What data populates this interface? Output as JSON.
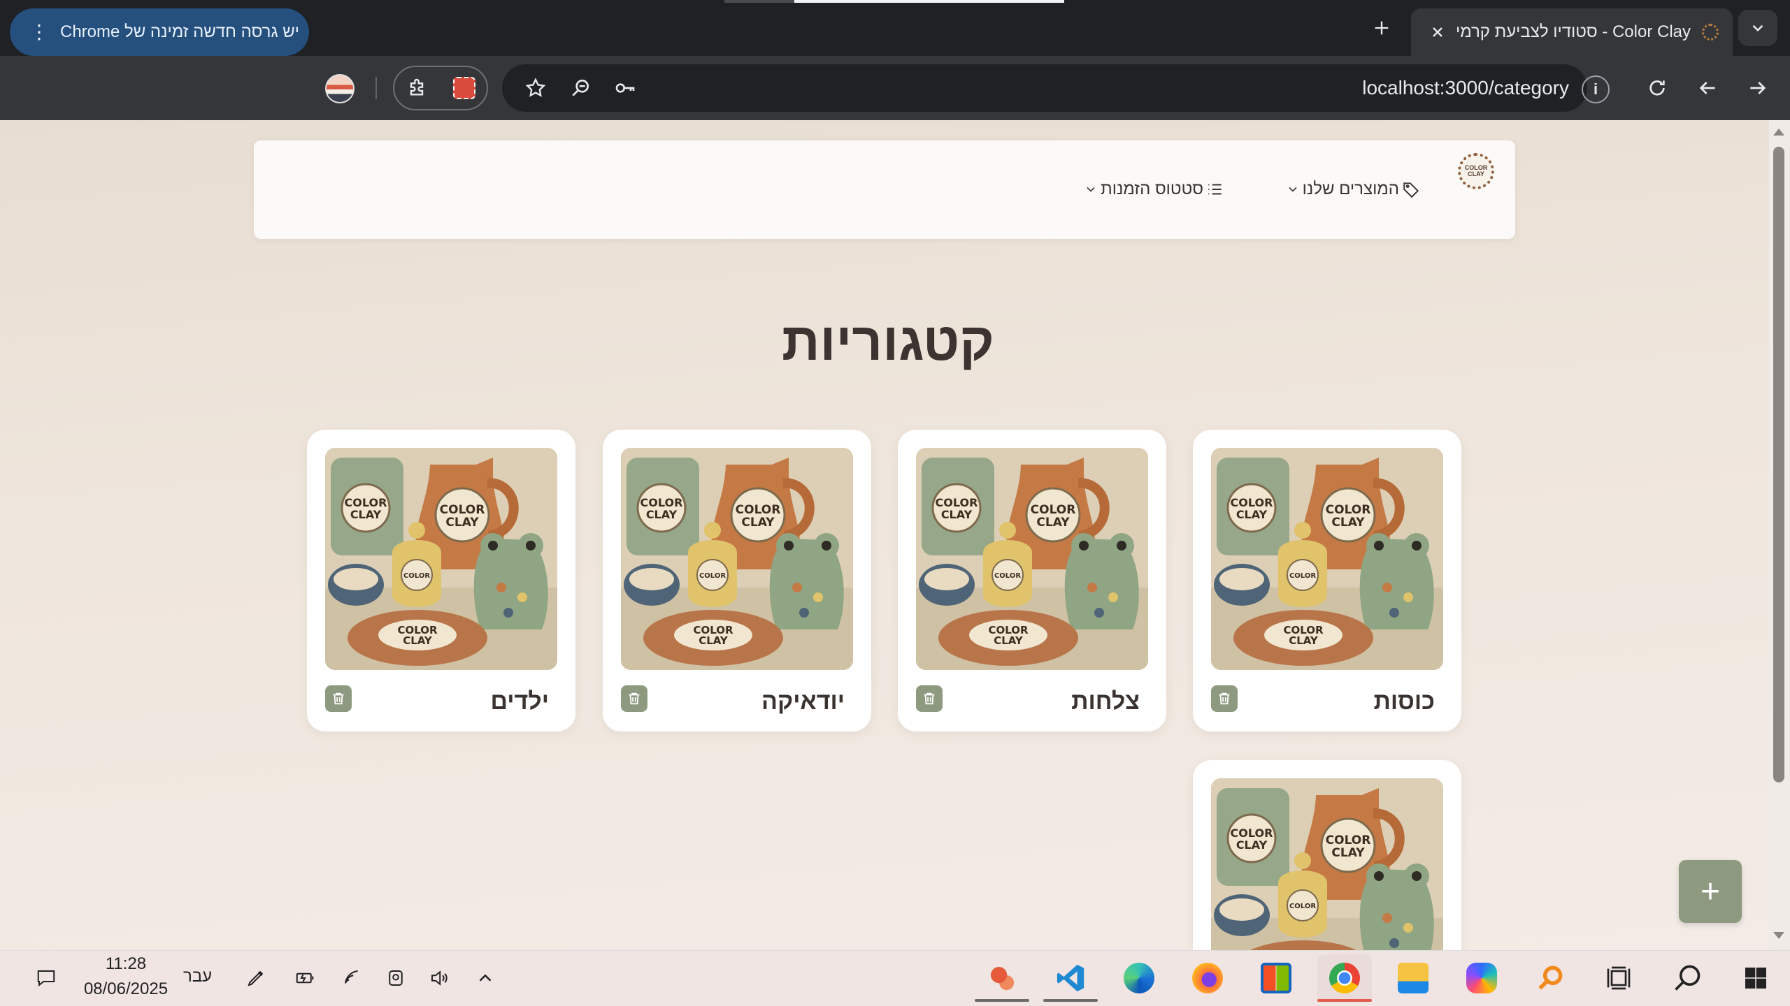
{
  "browser": {
    "tab_title": "Color Clay - סטודיו לצביעת קרמיקה",
    "url_host": "localhost",
    "url_path": ":3000/category",
    "update_chip_text": "יש גרסה חדשה זמינה של Chrome"
  },
  "navbar": {
    "products_label": "המוצרים שלנו",
    "orders_label": "סטטוס הזמנות",
    "logo_text": "COLOR CLAY"
  },
  "page": {
    "heading": "קטגוריות",
    "add_button_label": "+"
  },
  "categories": [
    {
      "name": "כוסות"
    },
    {
      "name": "צלחות"
    },
    {
      "name": "יודאיקה"
    },
    {
      "name": "ילדים"
    },
    {
      "name": ""
    }
  ],
  "taskbar": {
    "time": "11:28",
    "date": "08/06/2025",
    "language": "עבר"
  },
  "colors": {
    "accent_sage": "#8e9a80",
    "page_bg": "#efe6dd",
    "chrome_dark": "#202124"
  }
}
